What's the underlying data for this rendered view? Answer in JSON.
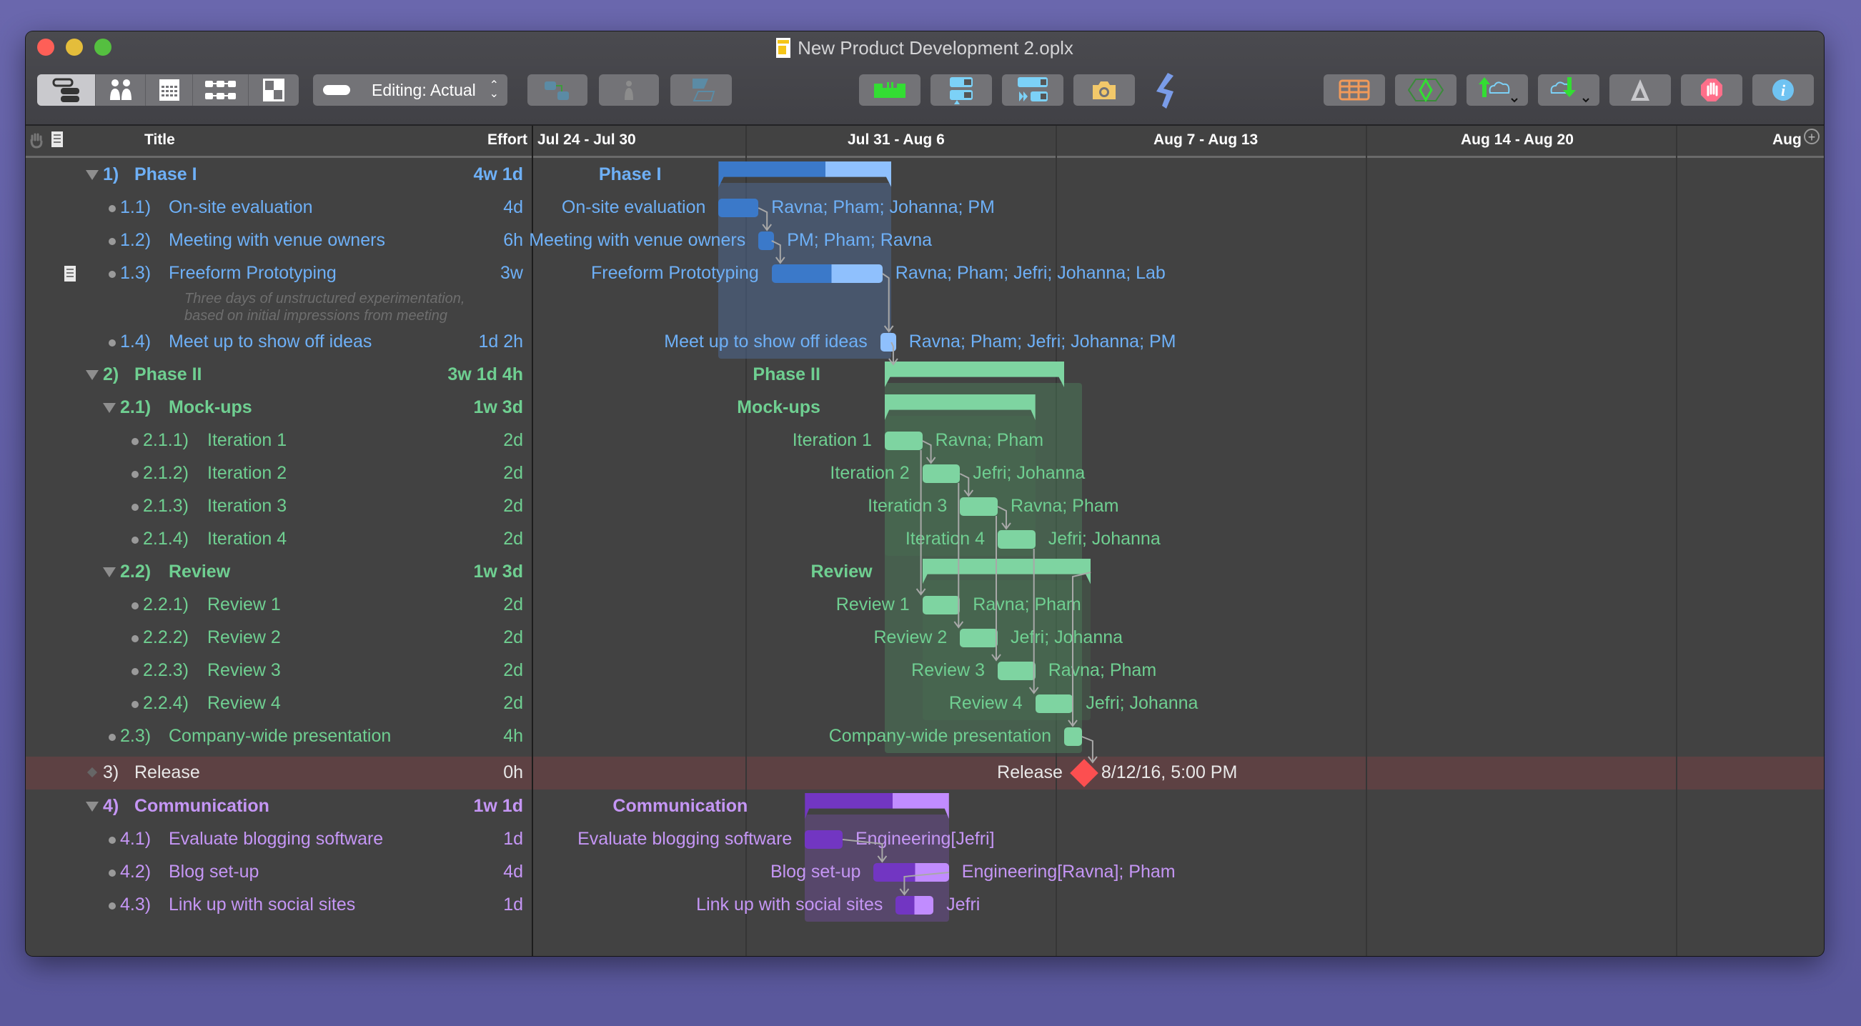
{
  "window": {
    "title": "New Product Development 2.oplx"
  },
  "toolbar": {
    "view_modes": [
      "gantt-view",
      "resource-view",
      "calendar-view",
      "network-view",
      "styles-view"
    ],
    "active_view": "gantt-view",
    "editing_label": "Editing: Actual",
    "left_tools": [
      "connect-tasks",
      "assign-resource",
      "split-task"
    ],
    "center_tools": [
      "level-resources",
      "baseline",
      "catch-up",
      "snapshot",
      "omni-logo"
    ],
    "right_tools": [
      "table-view",
      "critical-path",
      "publish",
      "subscribe",
      "violations",
      "stop",
      "inspector"
    ]
  },
  "columns": {
    "title": "Title",
    "effort": "Effort"
  },
  "timeline": {
    "weeks": [
      "Jul 24 - Jul 30",
      "Jul 31 - Aug 6",
      "Aug 7 - Aug 13",
      "Aug 14 - Aug 20",
      "Aug"
    ]
  },
  "colors": {
    "phase1": "#6eb0f7",
    "phase2": "#6fcf91",
    "release": "#fc4f50",
    "communication": "#c596f5"
  },
  "tasks": [
    {
      "num": "1)",
      "title": "Phase I",
      "effort": "4w 1d",
      "type": "group",
      "level": 0,
      "color": "blue",
      "gantt_label": "Phase I"
    },
    {
      "num": "1.1)",
      "title": "On-site evaluation",
      "effort": "4d",
      "type": "task",
      "level": 1,
      "color": "blue",
      "gantt_label": "On-site evaluation",
      "resources": "Ravna; Pham; Johanna; PM"
    },
    {
      "num": "1.2)",
      "title": "Meeting with venue owners",
      "effort": "6h",
      "type": "task",
      "level": 1,
      "color": "blue",
      "gantt_label": "Meeting with venue owners",
      "resources": "PM; Pham; Ravna"
    },
    {
      "num": "1.3)",
      "title": "Freeform Prototyping",
      "effort": "3w",
      "type": "task",
      "level": 1,
      "color": "blue",
      "gantt_label": "Freeform Prototyping",
      "resources": "Ravna; Pham; Jefri; Johanna; Lab",
      "note": "Three days of unstructured experimentation, based on initial impressions from meeting"
    },
    {
      "num": "1.4)",
      "title": "Meet up to show off ideas",
      "effort": "1d 2h",
      "type": "task",
      "level": 1,
      "color": "blue",
      "gantt_label": "Meet up to show off ideas",
      "resources": "Ravna; Pham; Jefri; Johanna; PM"
    },
    {
      "num": "2)",
      "title": "Phase II",
      "effort": "3w 1d 4h",
      "type": "group",
      "level": 0,
      "color": "green",
      "gantt_label": "Phase II"
    },
    {
      "num": "2.1)",
      "title": "Mock-ups",
      "effort": "1w 3d",
      "type": "group",
      "level": 1,
      "color": "green",
      "gantt_label": "Mock-ups"
    },
    {
      "num": "2.1.1)",
      "title": "Iteration 1",
      "effort": "2d",
      "type": "task",
      "level": 2,
      "color": "green",
      "gantt_label": "Iteration 1",
      "resources": "Ravna; Pham"
    },
    {
      "num": "2.1.2)",
      "title": "Iteration 2",
      "effort": "2d",
      "type": "task",
      "level": 2,
      "color": "green",
      "gantt_label": "Iteration 2",
      "resources": "Jefri; Johanna"
    },
    {
      "num": "2.1.3)",
      "title": "Iteration 3",
      "effort": "2d",
      "type": "task",
      "level": 2,
      "color": "green",
      "gantt_label": "Iteration 3",
      "resources": "Ravna; Pham"
    },
    {
      "num": "2.1.4)",
      "title": "Iteration 4",
      "effort": "2d",
      "type": "task",
      "level": 2,
      "color": "green",
      "gantt_label": "Iteration 4",
      "resources": "Jefri; Johanna"
    },
    {
      "num": "2.2)",
      "title": "Review",
      "effort": "1w 3d",
      "type": "group",
      "level": 1,
      "color": "green",
      "gantt_label": "Review"
    },
    {
      "num": "2.2.1)",
      "title": "Review 1",
      "effort": "2d",
      "type": "task",
      "level": 2,
      "color": "green",
      "gantt_label": "Review 1",
      "resources": "Ravna; Pham"
    },
    {
      "num": "2.2.2)",
      "title": "Review 2",
      "effort": "2d",
      "type": "task",
      "level": 2,
      "color": "green",
      "gantt_label": "Review 2",
      "resources": "Jefri; Johanna"
    },
    {
      "num": "2.2.3)",
      "title": "Review 3",
      "effort": "2d",
      "type": "task",
      "level": 2,
      "color": "green",
      "gantt_label": "Review 3",
      "resources": "Ravna; Pham"
    },
    {
      "num": "2.2.4)",
      "title": "Review 4",
      "effort": "2d",
      "type": "task",
      "level": 2,
      "color": "green",
      "gantt_label": "Review 4",
      "resources": "Jefri; Johanna"
    },
    {
      "num": "2.3)",
      "title": "Company-wide presentation",
      "effort": "4h",
      "type": "task",
      "level": 1,
      "color": "green",
      "gantt_label": "Company-wide presentation"
    },
    {
      "num": "3)",
      "title": "Release",
      "effort": "0h",
      "type": "milestone",
      "level": 0,
      "color": "white",
      "gantt_label": "Release",
      "date": "8/12/16, 5:00 PM"
    },
    {
      "num": "4)",
      "title": "Communication",
      "effort": "1w 1d",
      "type": "group",
      "level": 0,
      "color": "purple",
      "gantt_label": "Communication"
    },
    {
      "num": "4.1)",
      "title": "Evaluate blogging software",
      "effort": "1d",
      "type": "task",
      "level": 1,
      "color": "purple",
      "gantt_label": "Evaluate blogging software",
      "resources": "Engineering[Jefri]"
    },
    {
      "num": "4.2)",
      "title": "Blog set-up",
      "effort": "4d",
      "type": "task",
      "level": 1,
      "color": "purple",
      "gantt_label": "Blog set-up",
      "resources": "Engineering[Ravna]; Pham"
    },
    {
      "num": "4.3)",
      "title": "Link up with social sites",
      "effort": "1d",
      "type": "task",
      "level": 1,
      "color": "purple",
      "gantt_label": "Link up with social sites",
      "resources": "Jefri"
    }
  ]
}
